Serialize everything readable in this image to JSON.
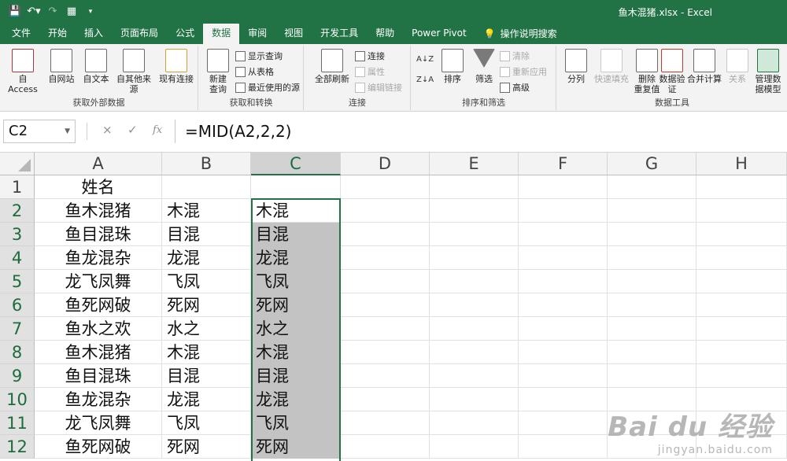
{
  "titlebar": {
    "title": "鱼木混猪.xlsx  -  Excel",
    "qat": {
      "save": "save-icon",
      "undo": "undo-icon",
      "redo": "redo-icon",
      "form": "form-icon",
      "customize": "customize-icon"
    }
  },
  "tabs": [
    "文件",
    "开始",
    "插入",
    "页面布局",
    "公式",
    "数据",
    "审阅",
    "视图",
    "开发工具",
    "帮助",
    "Power Pivot"
  ],
  "active_tab": "数据",
  "tell_me": "操作说明搜索",
  "ribbon": {
    "get_external": {
      "label": "获取外部数据",
      "buttons": [
        "自 Access",
        "自网站",
        "自文本",
        "自其他来源",
        "现有连接"
      ]
    },
    "get_transform": {
      "label": "获取和转换",
      "new_query": [
        "新建",
        "查询"
      ],
      "show_query": "显示查询",
      "from_table": "从表格",
      "recent_sources": "最近使用的源"
    },
    "connections": {
      "label": "连接",
      "refresh_all": "全部刷新",
      "connections": "连接",
      "properties": "属性",
      "edit_links": "编辑链接"
    },
    "sort_filter": {
      "label": "排序和筛选",
      "sort": "排序",
      "filter": "筛选",
      "clear": "清除",
      "reapply": "重新应用",
      "advanced": "高级"
    },
    "data_tools": {
      "label": "数据工具",
      "text_to_columns": "分列",
      "flash_fill": "快速填充",
      "remove_duplicates": [
        "删除",
        "重复值"
      ],
      "validation": [
        "数据验",
        "证"
      ],
      "consolidate": "合并计算",
      "relationships": "关系",
      "data_model": [
        "管理数",
        "据模型"
      ]
    }
  },
  "formula_bar": {
    "name_box": "C2",
    "cancel": "×",
    "enter": "✓",
    "fx": "fx",
    "formula": "=MID(A2,2,2)"
  },
  "grid": {
    "columns": [
      "A",
      "B",
      "C",
      "D",
      "E",
      "F",
      "G",
      "H"
    ],
    "selected_column": "C",
    "rows": [
      "1",
      "2",
      "3",
      "4",
      "5",
      "6",
      "7",
      "8",
      "9",
      "10",
      "11",
      "12"
    ],
    "col_a": [
      "姓名",
      "鱼木混猪",
      "鱼目混珠",
      "鱼龙混杂",
      "龙飞凤舞",
      "鱼死网破",
      "鱼水之欢",
      "鱼木混猪",
      "鱼目混珠",
      "鱼龙混杂",
      "龙飞凤舞",
      "鱼死网破"
    ],
    "col_b": [
      "",
      "木混",
      "目混",
      "龙混",
      "飞凤",
      "死网",
      "水之",
      "木混",
      "目混",
      "龙混",
      "飞凤",
      "死网"
    ],
    "col_c": [
      "",
      "木混",
      "目混",
      "龙混",
      "飞凤",
      "死网",
      "水之",
      "木混",
      "目混",
      "龙混",
      "飞凤",
      "死网"
    ]
  },
  "watermark": {
    "line1": "Bai du 经验",
    "line2": "jingyan.baidu.com"
  }
}
